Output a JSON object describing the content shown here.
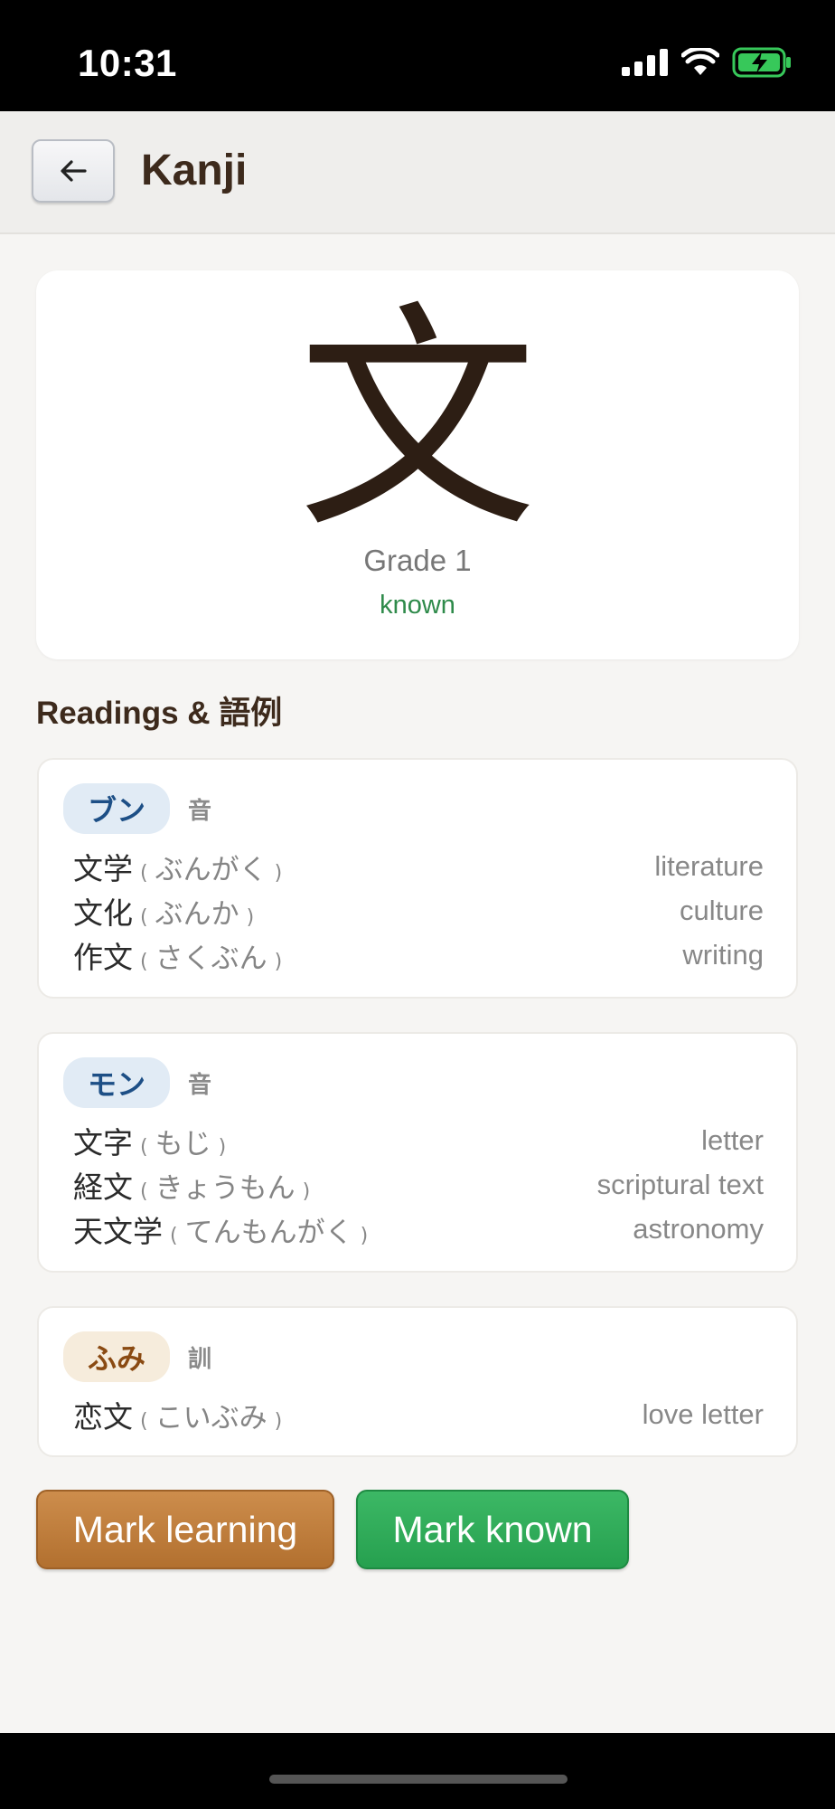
{
  "status_bar": {
    "time": "10:31"
  },
  "header": {
    "title": "Kanji",
    "back_icon": "arrow-left-icon"
  },
  "kanji": {
    "character": "文",
    "grade": "Grade 1",
    "status": "known"
  },
  "section_title": "Readings & 語例",
  "readings": [
    {
      "reading": "ブン",
      "type": "音",
      "style": "on",
      "examples": [
        {
          "word": "文学",
          "reading": "ぶんがく",
          "meaning": "literature"
        },
        {
          "word": "文化",
          "reading": "ぶんか",
          "meaning": "culture"
        },
        {
          "word": "作文",
          "reading": "さくぶん",
          "meaning": "writing"
        }
      ]
    },
    {
      "reading": "モン",
      "type": "音",
      "style": "on",
      "examples": [
        {
          "word": "文字",
          "reading": "もじ",
          "meaning": "letter"
        },
        {
          "word": "経文",
          "reading": "きょうもん",
          "meaning": "scriptural text"
        },
        {
          "word": "天文学",
          "reading": "てんもんがく",
          "meaning": "astronomy"
        }
      ]
    },
    {
      "reading": "ふみ",
      "type": "訓",
      "style": "kun",
      "examples": [
        {
          "word": "恋文",
          "reading": "こいぶみ",
          "meaning": "love letter"
        }
      ]
    }
  ],
  "paren_open": "(",
  "paren_close": ")",
  "buttons": {
    "mark_learning": "Mark learning",
    "mark_known": "Mark known"
  },
  "colors": {
    "known": "#2e8a4a",
    "learning_button": "#c0803f",
    "known_button": "#2fae5a",
    "title": "#3d2a1c"
  }
}
